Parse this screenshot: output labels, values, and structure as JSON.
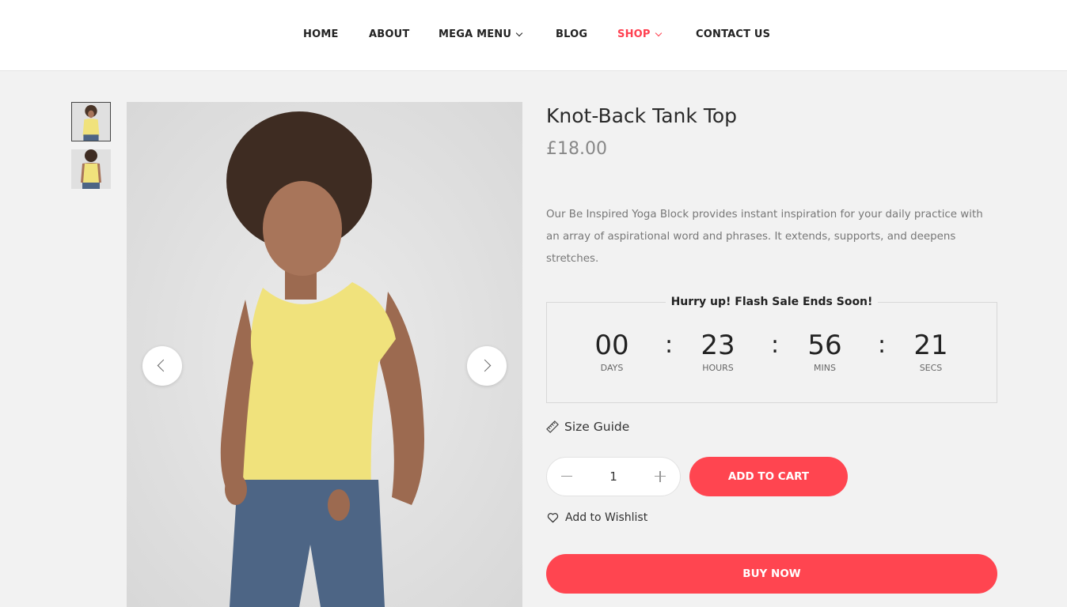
{
  "nav": {
    "items": [
      {
        "label": "HOME",
        "has_dropdown": false,
        "active": false
      },
      {
        "label": "ABOUT",
        "has_dropdown": false,
        "active": false
      },
      {
        "label": "MEGA MENU",
        "has_dropdown": true,
        "active": false
      },
      {
        "label": "BLOG",
        "has_dropdown": false,
        "active": false
      },
      {
        "label": "SHOP",
        "has_dropdown": true,
        "active": true
      },
      {
        "label": "CONTACT US",
        "has_dropdown": false,
        "active": false
      }
    ],
    "active_color": "#ff4050"
  },
  "gallery": {
    "thumbnails": [
      {
        "icon": "tank-top-front-thumbnail",
        "active": true
      },
      {
        "icon": "tank-top-back-thumbnail",
        "active": false
      }
    ],
    "prev_icon": "chevron-left-icon",
    "next_icon": "chevron-right-icon"
  },
  "product": {
    "title": "Knot-Back Tank Top",
    "price": "£18.00",
    "description": "Our Be Inspired Yoga Block provides instant inspiration for your daily practice with an array of aspirational word and phrases. It extends, supports, and deepens stretches."
  },
  "countdown": {
    "title": "Hurry up! Flash Sale Ends Soon!",
    "separator": ":",
    "units": [
      {
        "value": "00",
        "label": "DAYS"
      },
      {
        "value": "23",
        "label": "HOURS"
      },
      {
        "value": "56",
        "label": "MINS"
      },
      {
        "value": "21",
        "label": "SECS"
      }
    ]
  },
  "size_guide": {
    "label": "Size Guide",
    "icon": "ruler-icon"
  },
  "quantity": {
    "value": "1"
  },
  "actions": {
    "add_to_cart": "ADD TO CART",
    "wishlist": "Add to Wishlist",
    "wishlist_icon": "heart-icon",
    "buy_now": "BUY NOW",
    "accent_color": "#ff4550"
  }
}
